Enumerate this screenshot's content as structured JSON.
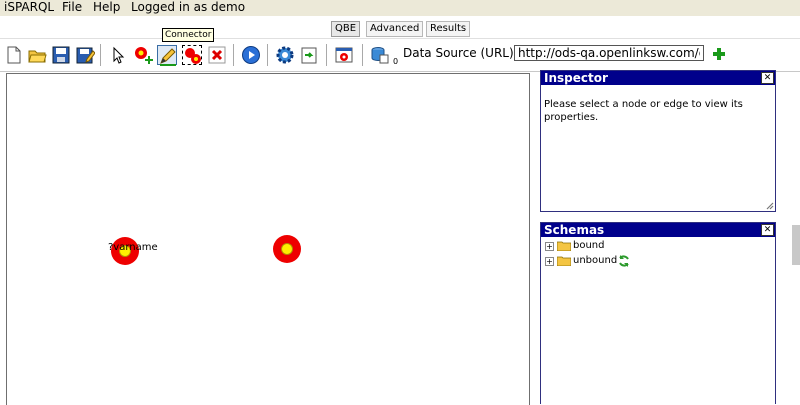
{
  "menubar": {
    "app_name": "iSPARQL",
    "file": "File",
    "help": "Help",
    "user_status": "Logged in as demo"
  },
  "tabs": [
    {
      "label": "QBE",
      "active": true
    },
    {
      "label": "Advanced",
      "active": false
    },
    {
      "label": "Results",
      "active": false
    }
  ],
  "toolbar": {
    "tooltip": "Connector",
    "badge": "0",
    "data_source_label": "Data Source (URL):",
    "data_source_value": "http://ods-qa.openlinksw.com/dataspace",
    "icons": [
      "new-document-icon",
      "open-folder-icon",
      "save-icon",
      "save-as-icon",
      "pointer-icon",
      "add-node-icon",
      "pencil-icon",
      "connector-icon",
      "delete-icon",
      "run-icon",
      "settings-icon",
      "import-icon",
      "view-results-icon",
      "dataset-icon",
      "add-source-icon"
    ]
  },
  "canvas": {
    "nodes": [
      {
        "label": "?varname"
      },
      {
        "label": ""
      }
    ]
  },
  "inspector": {
    "title": "Inspector",
    "message": "Please select a node or edge to view its properties."
  },
  "schemas": {
    "title": "Schemas",
    "items": [
      {
        "label": "bound"
      },
      {
        "label": "unbound"
      }
    ]
  },
  "colors": {
    "panel_header": "#00008b",
    "node_outer": "#ee0000",
    "node_inner": "#ffee00",
    "menubar_bg": "#ece9d8"
  }
}
